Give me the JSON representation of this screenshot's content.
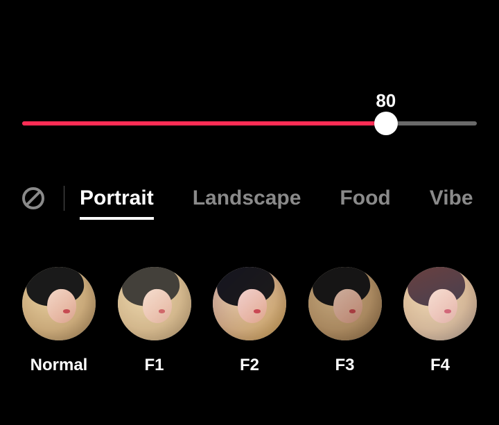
{
  "slider": {
    "value": 80,
    "min": 0,
    "max": 100
  },
  "categories": {
    "active_index": 0,
    "items": [
      "Portrait",
      "Landscape",
      "Food",
      "Vibe"
    ]
  },
  "filters": [
    {
      "label": "Normal",
      "overlay_css": "background:transparent;"
    },
    {
      "label": "F1",
      "overlay_css": "background:rgba(255,235,200,0.18);mix-blend-mode:screen;"
    },
    {
      "label": "F2",
      "overlay_css": "background:linear-gradient(135deg,rgba(60,60,180,0.45),rgba(255,190,80,0.25));mix-blend-mode:overlay;"
    },
    {
      "label": "F3",
      "overlay_css": "background:rgba(120,90,70,0.30);mix-blend-mode:multiply;"
    },
    {
      "label": "F4",
      "overlay_css": "background:linear-gradient(160deg,rgba(255,120,120,0.35),rgba(80,120,200,0.35));mix-blend-mode:screen;"
    }
  ]
}
